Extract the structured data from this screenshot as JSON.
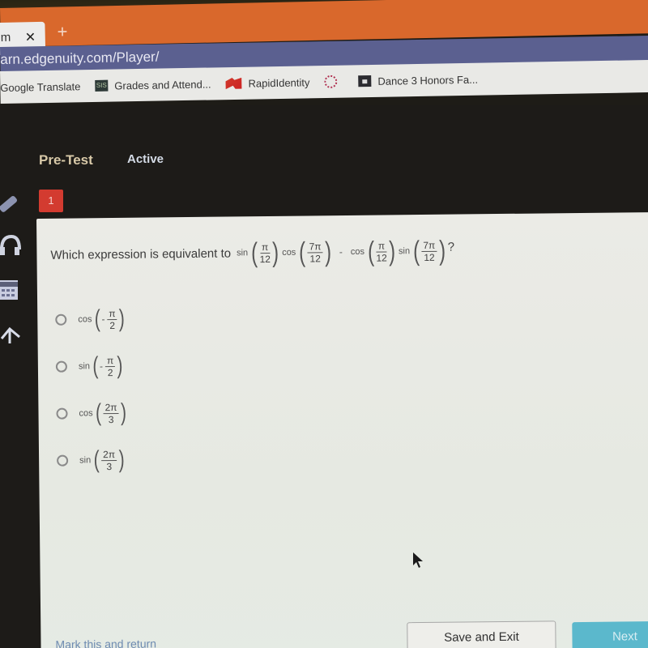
{
  "browser": {
    "tab": {
      "title_fragment": "m",
      "close_icon": "close-icon",
      "new_tab_label": "+"
    },
    "url": "arn.edgenuity.com/Player/",
    "bookmarks": [
      {
        "label": "Google Translate",
        "icon": "none"
      },
      {
        "label": "Grades and Attend...",
        "icon": "grades-icon"
      },
      {
        "label": "RapidIdentity",
        "icon": "rapididentity-icon"
      },
      {
        "label": "",
        "icon": "dotted-circle-icon"
      },
      {
        "label": "Dance 3 Honors Fa...",
        "icon": "classroom-icon"
      }
    ],
    "colors": {
      "tab_strip": "#d9682c",
      "address_bar": "#5b6090",
      "bookmarks_bar": "#e9e9e6"
    }
  },
  "header": {
    "activity": "Pre-Test",
    "status": "Active",
    "question_number": "1"
  },
  "tools": [
    "pencil-icon",
    "headphones-icon",
    "calculator-icon",
    "arrow-up-icon"
  ],
  "question": {
    "text": "Which expression is equivalent to",
    "terms": [
      {
        "fn": "sin",
        "num": "π",
        "den": "12"
      },
      {
        "fn": "cos",
        "num": "7π",
        "den": "12"
      },
      {
        "op": "-"
      },
      {
        "fn": "cos",
        "num": "π",
        "den": "12"
      },
      {
        "fn": "sin",
        "num": "7π",
        "den": "12"
      }
    ],
    "end": "?"
  },
  "options": [
    {
      "fn": "cos",
      "sign": "-",
      "num": "π",
      "den": "2",
      "selected": false
    },
    {
      "fn": "sin",
      "sign": "-",
      "num": "π",
      "den": "2",
      "selected": false
    },
    {
      "fn": "cos",
      "sign": "",
      "num": "2π",
      "den": "3",
      "selected": false
    },
    {
      "fn": "sin",
      "sign": "",
      "num": "2π",
      "den": "3",
      "selected": false
    }
  ],
  "footer": {
    "mark_return": "Mark this and return",
    "save_exit": "Save and Exit",
    "next": "Next"
  },
  "colors": {
    "question_badge": "#d33b30",
    "next_button": "#5bb8cc",
    "link": "#6e8bb1"
  }
}
